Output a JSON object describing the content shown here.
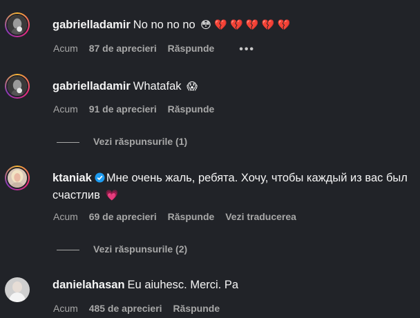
{
  "comments": [
    {
      "username": "gabrielladamir",
      "text": "No no no no",
      "emojis": "😳 💔 💔 💔 💔 💔",
      "time": "Acum",
      "likes": "87 de aprecieri",
      "reply": "Răspunde",
      "more": "•••"
    },
    {
      "username": "gabrielladamir",
      "text": "Whatafak",
      "emojis": "😱",
      "time": "Acum",
      "likes": "91 de aprecieri",
      "reply": "Răspunde",
      "view_replies": "Vezi răspunsurile (1)"
    },
    {
      "username": "ktaniak",
      "text": "Мне очень жаль, ребята. Хочу, чтобы каждый из вас был счастлив",
      "emojis": "💗",
      "time": "Acum",
      "likes": "69 de aprecieri",
      "reply": "Răspunde",
      "translate": "Vezi traducerea",
      "view_replies": "Vezi răspunsurile (2)"
    },
    {
      "username": "danielahasan",
      "text": "Eu aiuhesc. Merci. Pa",
      "time": "Acum",
      "likes": "485 de aprecieri",
      "reply": "Răspunde"
    }
  ],
  "colors": {
    "background": "#212328",
    "text": "#f5f5f5",
    "muted": "#a8a8a8",
    "verified": "#1d9bf0",
    "story_ring": "#ee2a7b"
  }
}
